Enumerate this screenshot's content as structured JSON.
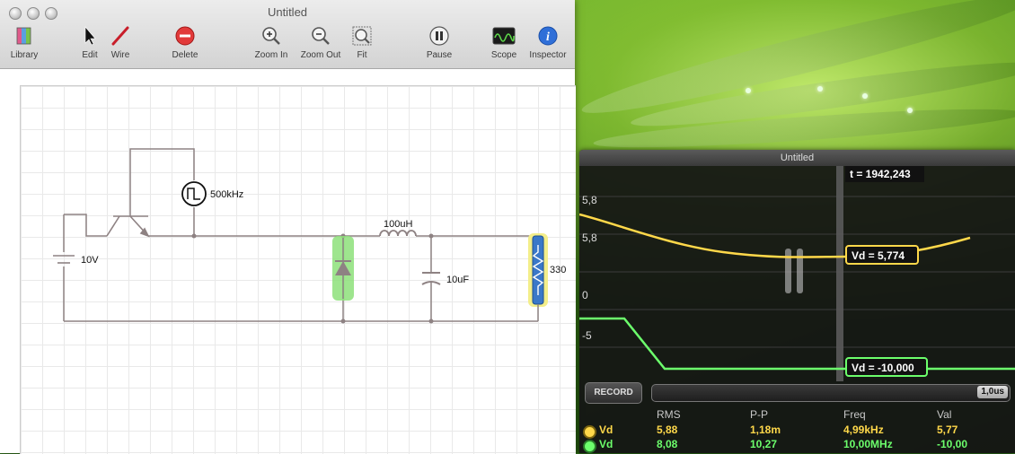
{
  "main_window": {
    "title": "Untitled",
    "toolbar": [
      {
        "id": "library",
        "label": "Library",
        "icon": "library-book-icon"
      },
      {
        "id": "edit",
        "label": "Edit",
        "icon": "pointer-arrow-icon"
      },
      {
        "id": "wire",
        "label": "Wire",
        "icon": "wire-pen-icon"
      },
      {
        "id": "delete",
        "label": "Delete",
        "icon": "delete-circle-icon"
      },
      {
        "id": "zoom_in",
        "label": "Zoom In",
        "icon": "zoom-in-icon"
      },
      {
        "id": "zoom_out",
        "label": "Zoom Out",
        "icon": "zoom-out-icon"
      },
      {
        "id": "fit",
        "label": "Fit",
        "icon": "fit-icon"
      },
      {
        "id": "pause",
        "label": "Pause",
        "icon": "pause-icon"
      },
      {
        "id": "scope",
        "label": "Scope",
        "icon": "scope-wave-icon"
      },
      {
        "id": "inspector",
        "label": "Inspector",
        "icon": "info-icon"
      }
    ]
  },
  "circuit": {
    "battery_label": "10V",
    "clock_label": "500kHz",
    "inductor_label": "100uH",
    "capacitor_label": "10uF",
    "resistor_label": "330"
  },
  "scope_window": {
    "title": "Untitled",
    "time_readout": "t = 1942,243",
    "axis_labels": [
      "5,8",
      "5,8",
      "0",
      "-5"
    ],
    "yellow_marker": "Vd = 5,774",
    "green_marker": "Vd = -10,000",
    "record_label": "RECORD",
    "timebase": "1,0us",
    "columns": [
      "RMS",
      "P-P",
      "Freq",
      "Val"
    ],
    "rows": [
      {
        "name": "Vd",
        "rms": "5,88",
        "pp": "1,18m",
        "freq": "4,99kHz",
        "val": "5,77",
        "color": "#ffd84a"
      },
      {
        "name": "Vd",
        "rms": "8,08",
        "pp": "10,27",
        "freq": "10,00MHz",
        "val": "-10,00",
        "color": "#6cff6c"
      }
    ]
  },
  "colors": {
    "trace_yellow": "#ffd84a",
    "trace_green": "#6cff6c",
    "wire_gray": "#8e8283",
    "highlight_green": "#8de07a",
    "highlight_yellow": "#f3ee8a"
  }
}
